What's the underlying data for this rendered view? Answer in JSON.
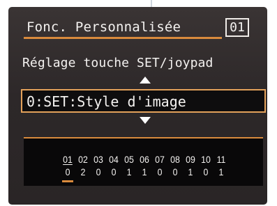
{
  "window": {
    "title": "Fonc. Personnalisée",
    "page_number": "01"
  },
  "setting": {
    "name": "Réglage touche SET/joypad",
    "selected_option": "0:SET:Style d'image"
  },
  "functions": {
    "numbers": [
      "01",
      "02",
      "03",
      "04",
      "05",
      "06",
      "07",
      "08",
      "09",
      "10",
      "11"
    ],
    "values": [
      "0",
      "2",
      "0",
      "0",
      "1",
      "1",
      "0",
      "0",
      "1",
      "0",
      "1"
    ],
    "current_index": 0
  },
  "colors": {
    "accent": "#d98a3d",
    "screen_bg": "#2d2829",
    "panel_bg": "#090809",
    "text": "#f4f2f0"
  },
  "icons": {
    "up": "triangle-up-icon",
    "down": "triangle-down-icon"
  }
}
